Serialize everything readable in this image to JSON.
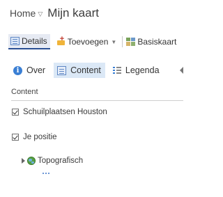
{
  "header": {
    "home_label": "Home",
    "home_caret": "▽",
    "map_title": "Mijn kaart"
  },
  "toolbar": {
    "details_label": "Details",
    "add_label": "Toevoegen",
    "add_caret": "▼",
    "basemap_label": "Basiskaart"
  },
  "tabs": [
    {
      "label": "Over",
      "icon": "info-icon",
      "active": false
    },
    {
      "label": "Content",
      "icon": "content-icon",
      "active": true
    },
    {
      "label": "Legenda",
      "icon": "legend-icon",
      "active": false
    }
  ],
  "content": {
    "section_title": "Content",
    "layers": [
      {
        "label": "Schuilplaatsen Houston",
        "checked": true
      },
      {
        "label": "Je positie",
        "checked": true
      }
    ],
    "basemap_layer": {
      "label": "Topografisch",
      "icon": "globe-icon"
    }
  },
  "colors": {
    "accent": "#2a4f94",
    "active_tab_bg": "#dbe8f6",
    "info_blue": "#3a7fd4"
  }
}
